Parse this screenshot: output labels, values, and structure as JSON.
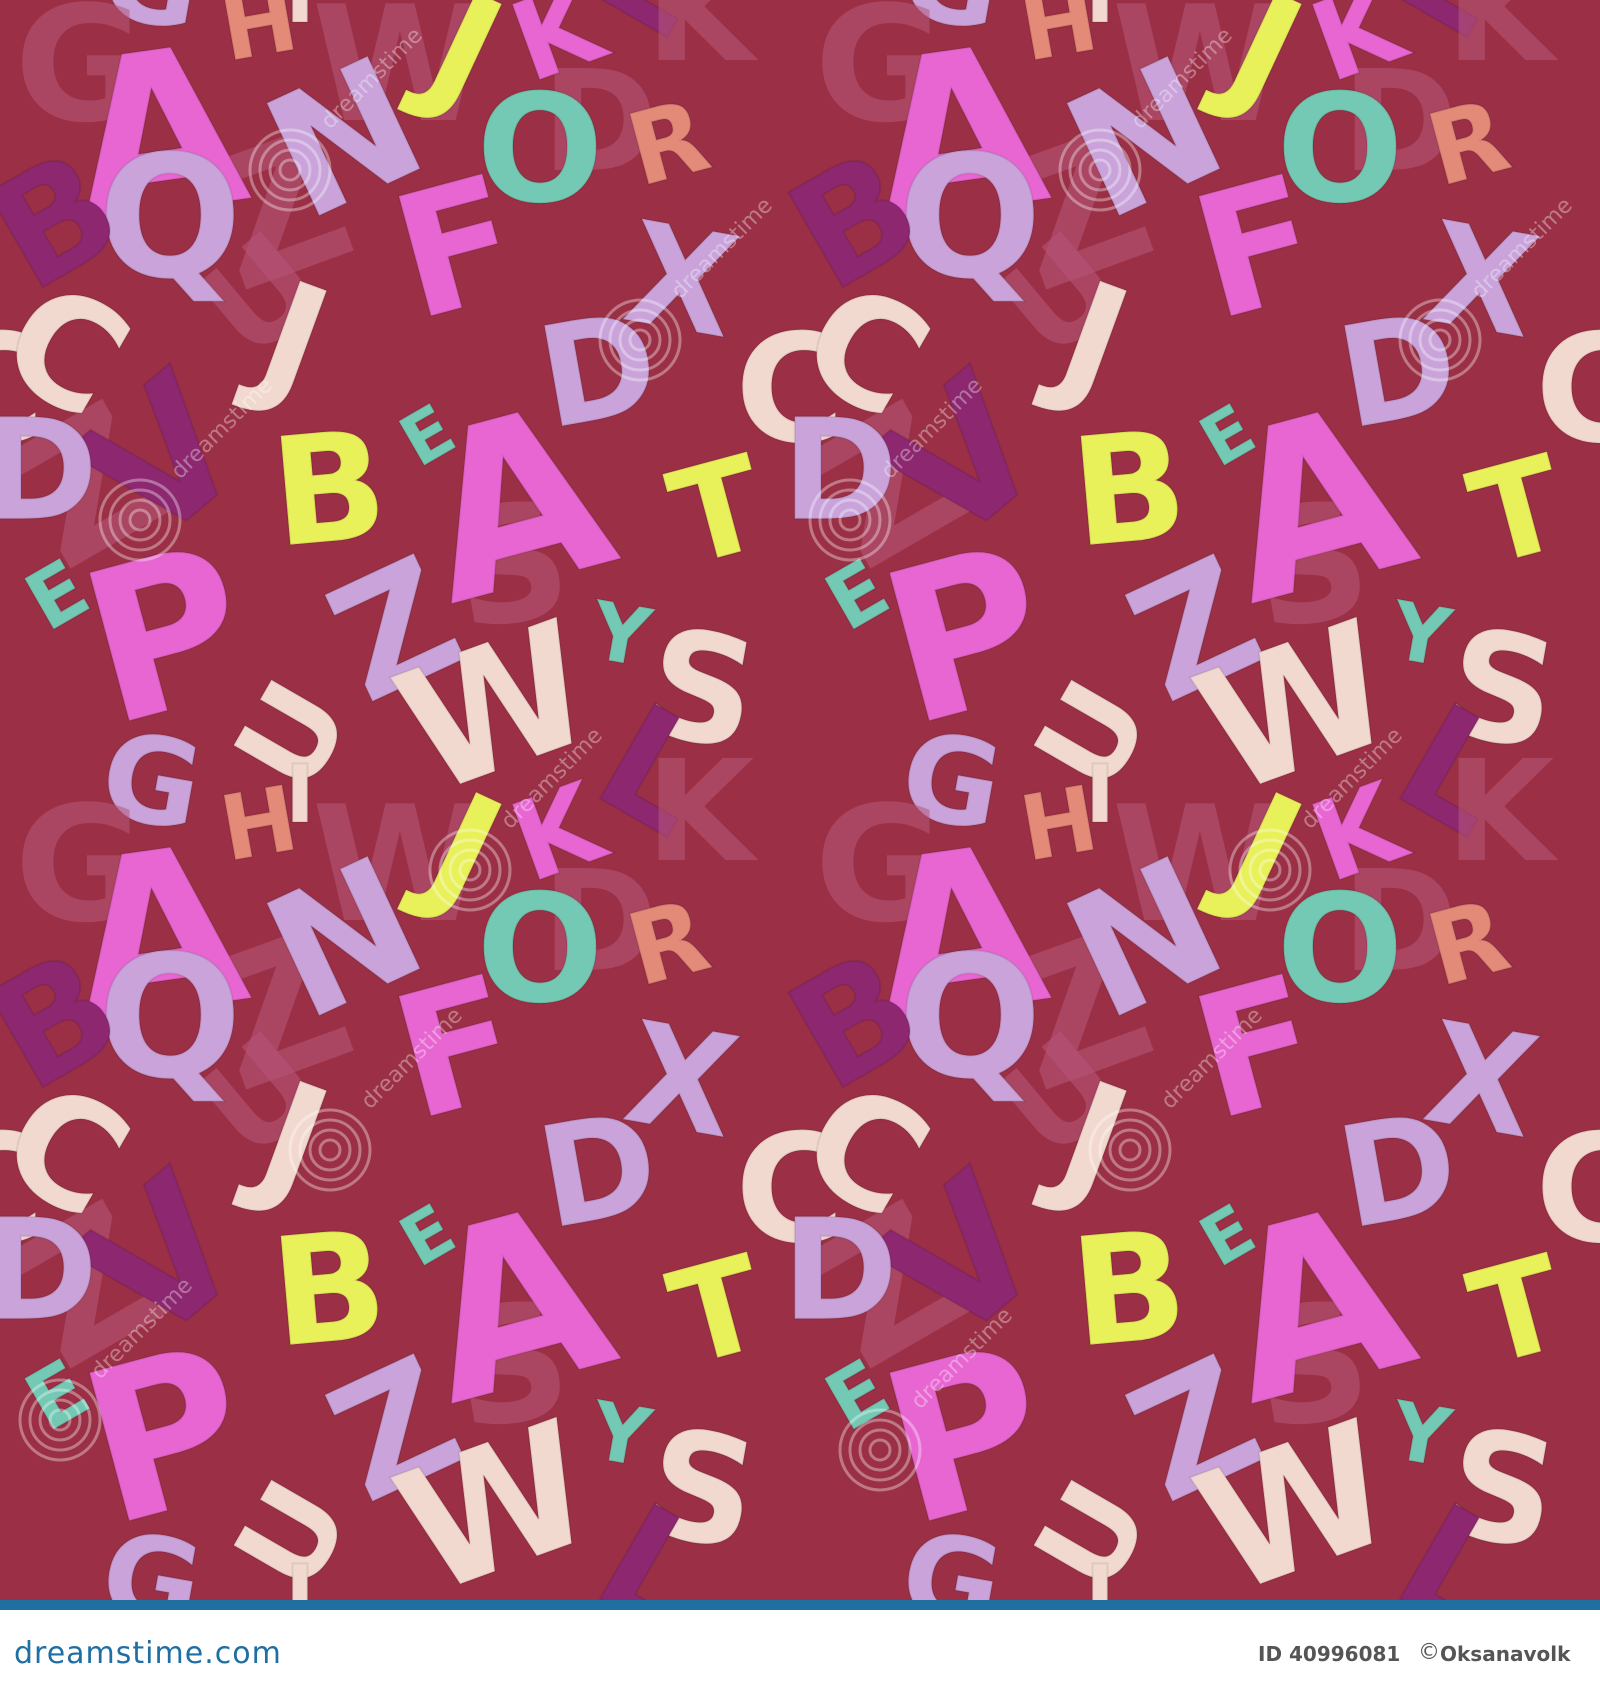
{
  "background_color": "#9b2f45",
  "palette": [
    "#e766d2",
    "#c9a3da",
    "#e8f05a",
    "#74c9b4",
    "#f2d9cf",
    "#8c2770",
    "#e48a78"
  ],
  "letters": [
    "A",
    "B",
    "C",
    "D",
    "E",
    "F",
    "G",
    "H",
    "I",
    "J",
    "K",
    "L",
    "N",
    "O",
    "P",
    "Q",
    "R",
    "S",
    "T",
    "U",
    "V",
    "W",
    "X",
    "Y",
    "Z"
  ],
  "watermark": "dreamstime",
  "footer": {
    "logo": "dreamstime.com",
    "id_label": "ID 40996081",
    "copyright_icon": "copyright-icon",
    "author": "Oksanavolk"
  }
}
